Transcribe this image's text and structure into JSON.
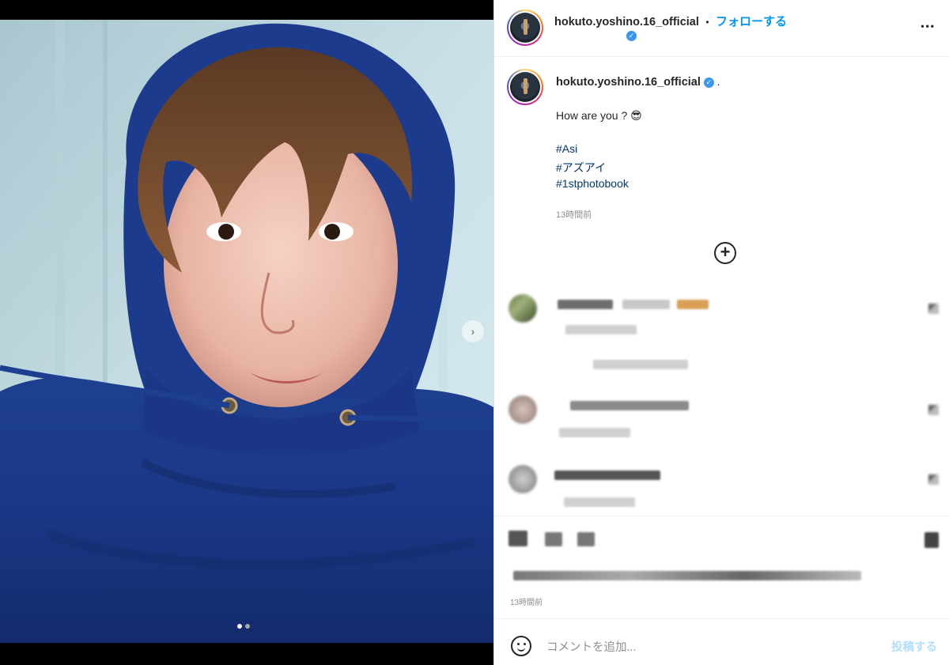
{
  "header": {
    "username": "hokuto.yoshino.16_official",
    "separator": "•",
    "follow_label": "フォローする",
    "more_label": "•••"
  },
  "caption": {
    "username": "hokuto.yoshino.16_official",
    "trailing": ".",
    "line1": "How are you ?",
    "emoji": "😎",
    "hashtags": [
      "#Asi",
      "#アズアイ",
      "#1stphotobook"
    ],
    "time": "13時間前"
  },
  "footer": {
    "time": "13時間前"
  },
  "comment_bar": {
    "placeholder": "コメントを追加...",
    "post_label": "投稿する"
  },
  "carousel": {
    "current_index": 1,
    "total": 2
  },
  "colors": {
    "link": "#0095f6",
    "hashtag": "#00376b",
    "verified": "#3897f0"
  }
}
